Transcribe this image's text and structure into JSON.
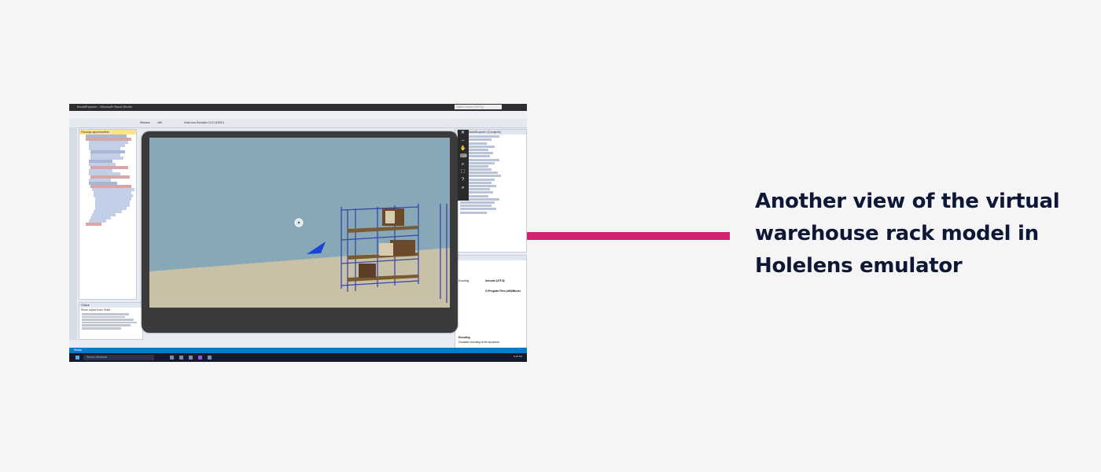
{
  "caption": {
    "text": "Another view of the virtual warehouse rack model in Holelens emulator"
  },
  "screenshot": {
    "window_title": "ModelExplorer - Microsoft Visual Studio",
    "search_placeholder": "Quick Launch (Ctrl+Q)",
    "menu": [
      "File",
      "Edit",
      "View",
      "Project",
      "Build",
      "Debug",
      "Team",
      "Tools",
      "Test",
      "Analyze",
      "Window",
      "Help"
    ],
    "toolbar": {
      "platform": "Release",
      "arch": "x86",
      "target": "HoloLens Emulator 10.0.14393.0"
    },
    "editor_tab": "Package.appxmanifest",
    "output_title": "Output",
    "output_tab": "Show output from: Build",
    "solution_title": "Solution 'ModelExplorer' (2 projects)",
    "properties": {
      "encoding_label": "Encoding",
      "encoding_value": "Unicode (UTF-8)",
      "path_value": "C:\\Program Files (x86)\\Micros",
      "footer_title": "Encoding",
      "footer_desc": "Character encoding of the document."
    },
    "status": "Ready",
    "taskbar_search": "Search Windows",
    "clock": "9:15 AM"
  },
  "colors": {
    "accent": "#d0246e",
    "caption_text": "#0e1836",
    "sky": "#87a9b7",
    "floor": "#c9c0a8",
    "rack_frame": "#3b46a8",
    "shelf": "#7a5a33",
    "box": "#6b4a2c"
  }
}
